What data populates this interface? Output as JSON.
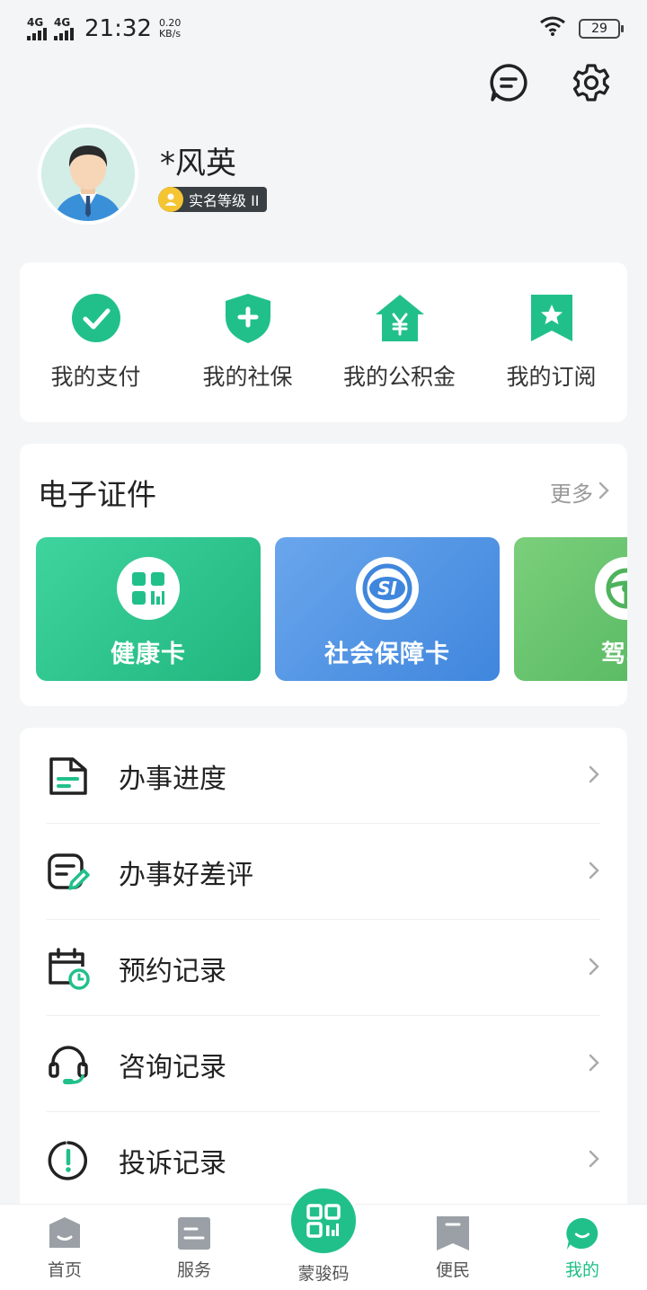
{
  "status_bar": {
    "network1": "4G",
    "network2": "4G",
    "time": "21:32",
    "speed_value": "0.20",
    "speed_unit": "KB/s",
    "battery": "29"
  },
  "profile": {
    "name": "*风英",
    "level": "实名等级 II"
  },
  "quick_actions": [
    {
      "label": "我的支付",
      "icon": "check-circle-icon"
    },
    {
      "label": "我的社保",
      "icon": "shield-plus-icon"
    },
    {
      "label": "我的公积金",
      "icon": "house-yen-icon"
    },
    {
      "label": "我的订阅",
      "icon": "bookmark-star-icon"
    }
  ],
  "certificates": {
    "title": "电子证件",
    "more": "更多",
    "items": [
      {
        "label": "健康卡",
        "icon": "qr-grid-icon",
        "color": "#2cc48e"
      },
      {
        "label": "社会保障卡",
        "icon": "si-logo-icon",
        "color": "#4f93e4"
      },
      {
        "label": "驾驶",
        "icon": "steering-wheel-icon",
        "color": "#62c26a"
      }
    ]
  },
  "menu": [
    {
      "label": "办事进度",
      "icon": "document-icon"
    },
    {
      "label": "办事好差评",
      "icon": "edit-note-icon"
    },
    {
      "label": "预约记录",
      "icon": "calendar-clock-icon"
    },
    {
      "label": "咨询记录",
      "icon": "headset-icon"
    },
    {
      "label": "投诉记录",
      "icon": "alert-circle-icon"
    }
  ],
  "tabbar": [
    {
      "label": "首页",
      "icon": "home-icon"
    },
    {
      "label": "服务",
      "icon": "service-icon"
    },
    {
      "label": "蒙骏码",
      "icon": "qr-code-icon"
    },
    {
      "label": "便民",
      "icon": "bookmark-icon"
    },
    {
      "label": "我的",
      "icon": "profile-icon"
    }
  ],
  "colors": {
    "accent": "#21c08b",
    "background": "#f4f5f6"
  }
}
